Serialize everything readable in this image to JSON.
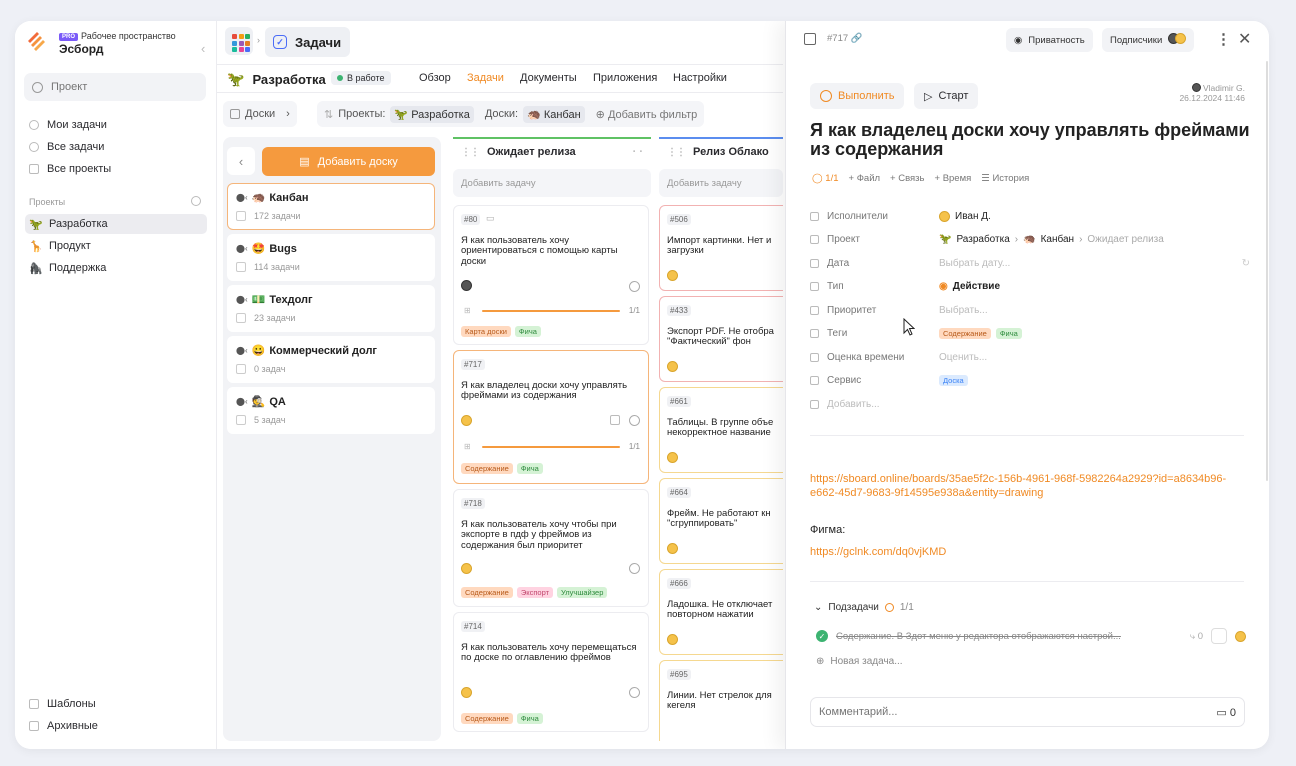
{
  "workspace": {
    "badge": "PRO",
    "label": "Рабочее пространство",
    "name": "Эсборд"
  },
  "sidebar": {
    "search_placeholder": "Проект",
    "nav": [
      "Мои задачи",
      "Все задачи",
      "Все проекты"
    ],
    "projects_title": "Проекты",
    "projects": [
      {
        "label": "Разработка",
        "emoji": "🦖"
      },
      {
        "label": "Продукт",
        "emoji": "🦒"
      },
      {
        "label": "Поддержка",
        "emoji": "🦍"
      }
    ],
    "bottom": [
      "Шаблоны",
      "Архивные"
    ]
  },
  "topbar": {
    "tab": "Задачи"
  },
  "project": {
    "name": "Разработка",
    "status": "В работе",
    "tabs": [
      "Обзор",
      "Задачи",
      "Документы",
      "Приложения",
      "Настройки"
    ],
    "active_tab": "Задачи"
  },
  "filters": {
    "boards": "Доски",
    "projects_label": "Проекты:",
    "projects_value": "Разработка",
    "boards_label": "Доски:",
    "boards_value": "Канбан",
    "add_filter": "Добавить фильтр"
  },
  "boards": {
    "add": "Добавить доску",
    "items": [
      {
        "name": "Канбан",
        "emoji": "🦔",
        "count": "172 задачи"
      },
      {
        "name": "Bugs",
        "emoji": "🤩",
        "count": "114 задачи"
      },
      {
        "name": "Техдолг",
        "emoji": "💵",
        "count": "23 задачи"
      },
      {
        "name": "Коммерческий долг",
        "emoji": "😀",
        "count": "0 задач"
      },
      {
        "name": "QA",
        "emoji": "🕵",
        "count": "5 задач"
      }
    ]
  },
  "columns": [
    {
      "title": "Ожидает релиза",
      "add": "Добавить задачу",
      "cards": [
        {
          "id": "#80",
          "title": "Я как пользователь хочу ориентироваться с помощью карты доски",
          "progress": "1/1",
          "tags": [
            "Карта доски",
            "Фича"
          ]
        },
        {
          "id": "#717",
          "title": "Я как владелец доски хочу управлять фреймами из содержания",
          "progress": "1/1",
          "tags": [
            "Содержание",
            "Фича"
          ]
        },
        {
          "id": "#718",
          "title": "Я как пользователь хочу чтобы при экспорте в пдф у фреймов из содержания был приоритет",
          "tags": [
            "Содержание",
            "Экспорт",
            "Улучшайзер"
          ]
        },
        {
          "id": "#714",
          "title": "Я как пользователь хочу перемещаться по доске по оглавлению фреймов",
          "tags": [
            "Содержание",
            "Фича"
          ]
        }
      ]
    },
    {
      "title": "Релиз Облако",
      "add": "Добавить задачу",
      "cards": [
        {
          "id": "#506",
          "title": "Импорт картинки. Нет и загрузки"
        },
        {
          "id": "#433",
          "title": "Экспорт PDF. Не отобра \"Фактический\" фон"
        },
        {
          "id": "#661",
          "title": "Таблицы. В группе объе некорректное название"
        },
        {
          "id": "#664",
          "title": "Фрейм. Не работают кн \"сгруппировать\""
        },
        {
          "id": "#666",
          "title": "Ладошка. Не отключает повторном нажатии"
        },
        {
          "id": "#695",
          "title": "Линии. Нет стрелок для кегеля"
        }
      ]
    }
  ],
  "panel": {
    "id": "#717",
    "privacy": "Приватность",
    "subscribers": "Подписчики",
    "do_btn": "Выполнить",
    "start_btn": "Старт",
    "author": "Vladimir G.",
    "date": "26.12.2024 11:46",
    "title": "Я как владелец доски хочу управлять фреймами из содержания",
    "meta": {
      "progress": "1/1",
      "file": "Файл",
      "link": "Связь",
      "time": "Время",
      "history": "История"
    },
    "props": [
      {
        "label": "Исполнители",
        "value": "Иван Д."
      },
      {
        "label": "Проект",
        "value": "Разработка",
        "board": "Канбан",
        "column": "Ожидает релиза"
      },
      {
        "label": "Дата",
        "value": "Выбрать дату..."
      },
      {
        "label": "Тип",
        "value": "Действие"
      },
      {
        "label": "Приоритет",
        "value": "Выбрать..."
      },
      {
        "label": "Теги",
        "tags": [
          "Содержание",
          "Фича"
        ]
      },
      {
        "label": "Оценка времени",
        "value": "Оценить..."
      },
      {
        "label": "Сервис",
        "tags": [
          "Доска"
        ]
      },
      {
        "label": "Добавить..."
      }
    ],
    "link1": "https://sboard.online/boards/35ae5f2c-156b-4961-968f-5982264a2929?id=a8634b96-e662-45d7-9683-9f14595e938a&entity=drawing",
    "figma_label": "Фигма:",
    "link2": "https://gclnk.com/dq0vjKMD",
    "subtasks_label": "Подзадачи",
    "subtasks_count": "1/1",
    "subtask": "Содержание. В Здот меню у редактора отображаются настрой...",
    "subtask_links": "0",
    "new_task": "Новая задача...",
    "comment_placeholder": "Комментарий...",
    "comment_count": "0"
  }
}
